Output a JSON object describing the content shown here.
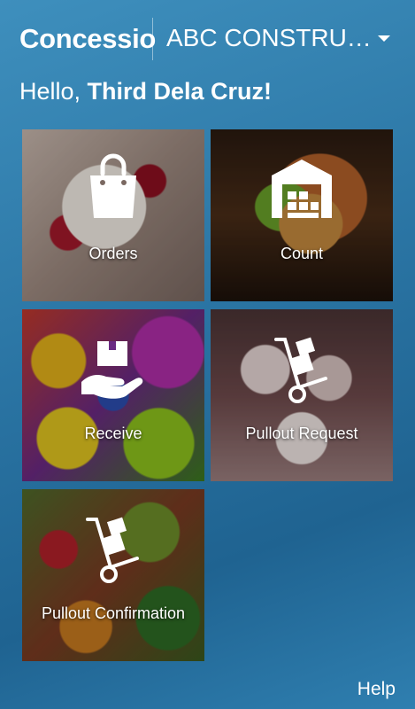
{
  "header": {
    "brand": "Concessio",
    "company": "ABC CONSTRU…"
  },
  "greeting": {
    "prefix": "Hello, ",
    "name": "Third Dela Cruz!"
  },
  "tiles": [
    {
      "label": "Orders",
      "icon": "shopping-bag-icon"
    },
    {
      "label": "Count",
      "icon": "warehouse-icon"
    },
    {
      "label": "Receive",
      "icon": "hand-package-icon"
    },
    {
      "label": "Pullout Request",
      "icon": "hand-truck-icon"
    },
    {
      "label": "Pullout Confirmation",
      "icon": "hand-truck-icon"
    }
  ],
  "footer": {
    "help": "Help"
  }
}
